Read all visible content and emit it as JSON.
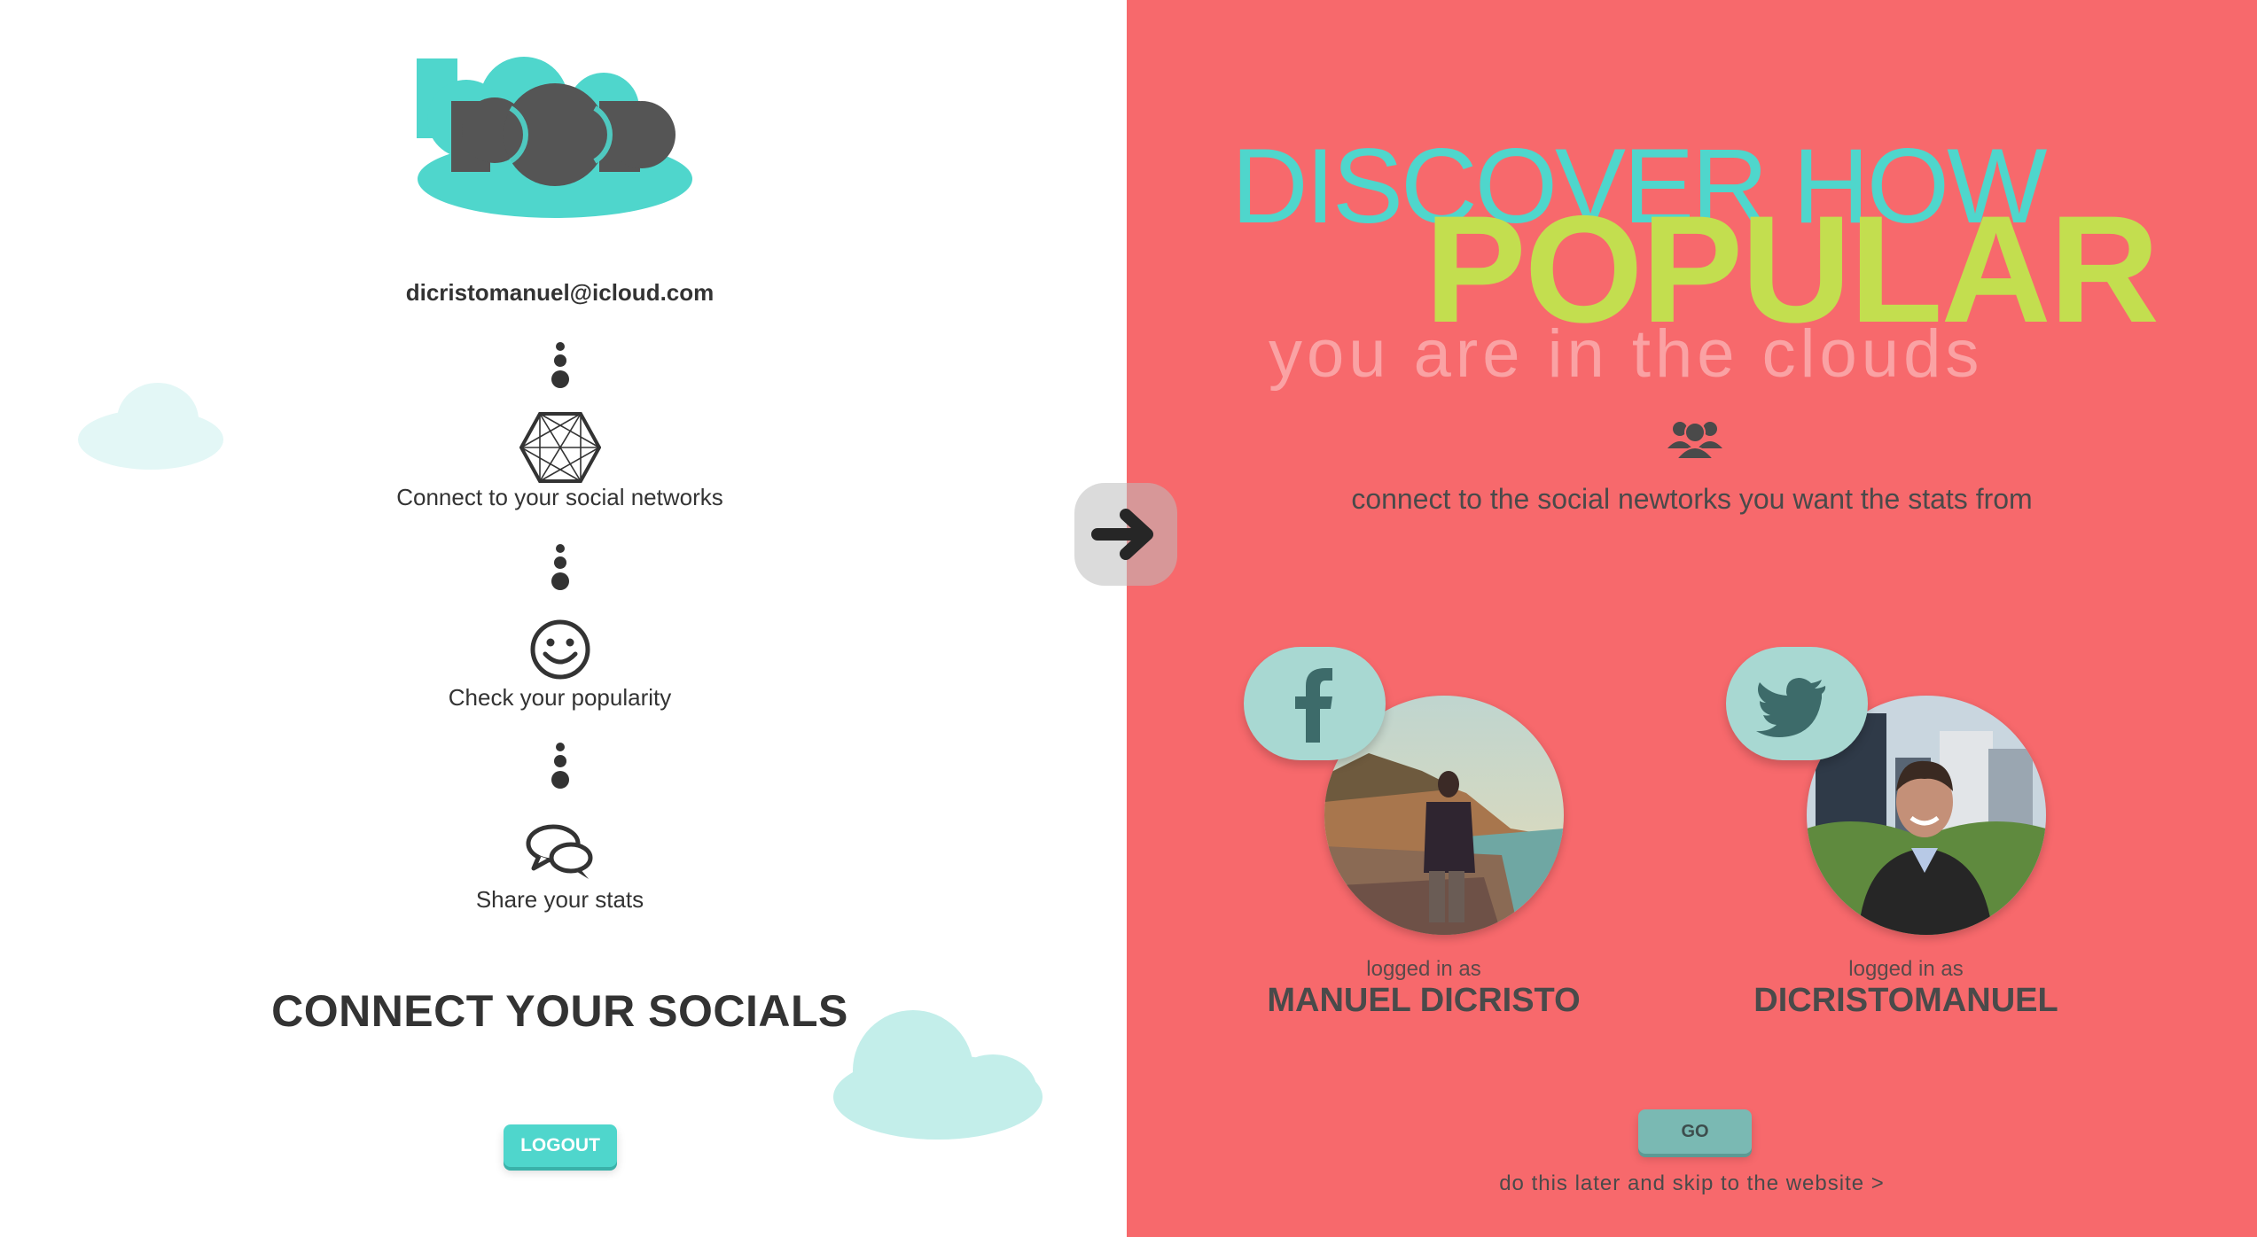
{
  "brand": {
    "logo_icon": "bpop-logo",
    "accent_color": "#4fd6cc",
    "dark_color": "#555555"
  },
  "user": {
    "email": "dicristomanuel@icloud.com"
  },
  "steps": [
    {
      "icon": "network-icon",
      "label": "Connect to your social networks"
    },
    {
      "icon": "smiley-icon",
      "label": "Check your popularity"
    },
    {
      "icon": "chat-bubbles-icon",
      "label": "Share your stats"
    }
  ],
  "left": {
    "title": "CONNECT YOUR SOCIALS",
    "logout_label": "LOGOUT"
  },
  "nav": {
    "arrow_icon": "arrow-right-icon"
  },
  "right": {
    "background": "#f7696c",
    "heading_line1": "DISCOVER HOW",
    "heading_line2": "POPULAR",
    "heading_line3": "you are in the clouds",
    "subtitle": "connect to the social newtorks you want the stats from",
    "go_label": "GO",
    "skip_label": "do this later and skip to the website >"
  },
  "accounts": [
    {
      "network": "facebook",
      "icon": "facebook-icon",
      "logged_label": "logged in as",
      "name": "MANUEL DICRISTO"
    },
    {
      "network": "twitter",
      "icon": "twitter-icon",
      "logged_label": "logged in as",
      "name": "DICRISTOMANUEL"
    }
  ]
}
